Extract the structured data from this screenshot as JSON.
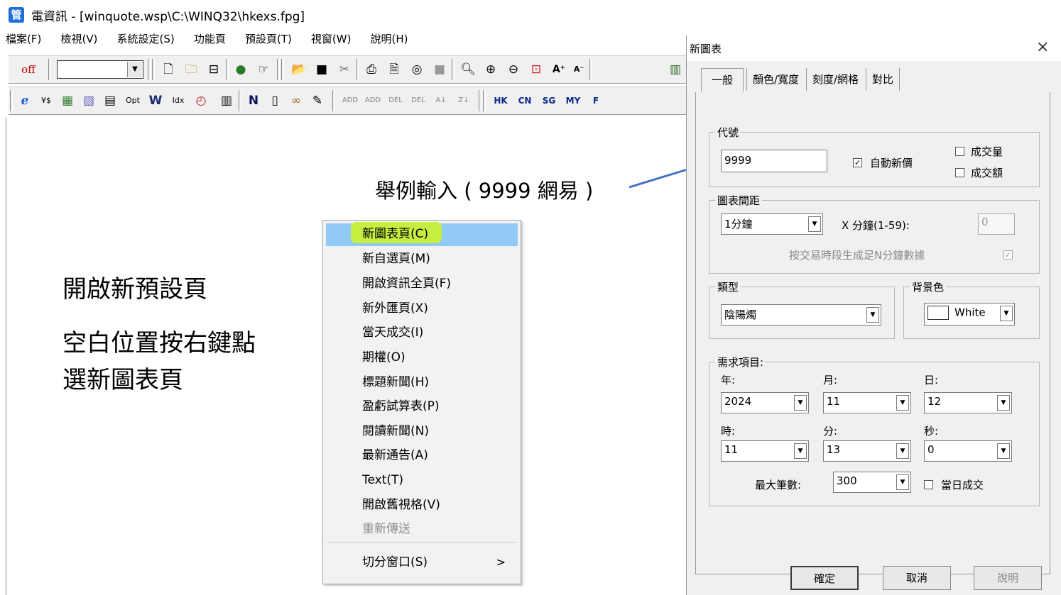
{
  "window": {
    "title": "電資訊 - [winquote.wsp\\C:\\WINQ32\\hkexs.fpg]",
    "icon": "app-icon"
  },
  "menubar": [
    "檔案(F)",
    "檢視(V)",
    "系統設定(S)",
    "功能頁",
    "預設頁(T)",
    "視窗(W)",
    "說明(H)"
  ],
  "toolbar1": {
    "off_label": "off",
    "combo_value": "",
    "icons": [
      "new-page-icon",
      "open-folder-icon",
      "minus-window-icon",
      "globe-icon",
      "hand-pointer-icon",
      "open-file-icon",
      "save-icon",
      "cut-icon",
      "print-icon",
      "print-preview-icon",
      "view-icon",
      "gray-box-icon",
      "search-icon",
      "zoom-in-icon",
      "zoom-out-icon",
      "target-icon",
      "font-larger-icon",
      "font-smaller-icon",
      "chart-icon"
    ]
  },
  "toolbar2": {
    "icons": [
      "ie-icon",
      "currency-icon",
      "grid-icon",
      "chart-line-icon",
      "table-icon",
      "option-icon",
      "w-icon",
      "index-icon",
      "clock-icon",
      "calculator-icon",
      "n-icon",
      "book-icon",
      "binoculars-icon",
      "pen-icon"
    ],
    "sort_buttons": [
      "ADD",
      "ADD",
      "DEL",
      "DEL",
      "A↓",
      "Z↓"
    ],
    "market_buttons": [
      "HK",
      "CN",
      "SG",
      "MY",
      "F"
    ]
  },
  "annotation": {
    "example": "舉例輸入 ( 9999 網易 )",
    "instr_title": "開啟新預設頁",
    "instr_line1": "空白位置按右鍵點",
    "instr_line2": "選新圖表頁"
  },
  "context_menu": {
    "items": [
      {
        "label": "新圖表頁(C)",
        "highlighted": true
      },
      {
        "label": "新自選頁(M)"
      },
      {
        "label": "開啟資訊全頁(F)"
      },
      {
        "label": "新外匯頁(X)"
      },
      {
        "label": "當天成交(I)"
      },
      {
        "label": "期權(O)"
      },
      {
        "label": "標題新聞(H)"
      },
      {
        "label": "盈虧試算表(P)"
      },
      {
        "label": "閱讀新聞(N)"
      },
      {
        "label": "最新通告(A)"
      },
      {
        "label": "Text(T)"
      },
      {
        "label": "開啟舊視格(V)"
      },
      {
        "label": "重新傳送",
        "disabled": true
      },
      {
        "label": "切分窗口(S)",
        "submenu": true
      }
    ],
    "submenu_arrow": ">"
  },
  "dialog": {
    "title": "新圖表",
    "close": "×",
    "tabs": [
      "一般",
      "顏色/寬度",
      "刻度/網格",
      "對比"
    ],
    "code_group": {
      "label": "代號",
      "code_value": "9999",
      "auto_new_price_label": "自動新價",
      "auto_new_price_checked": "✓",
      "volume_label": "成交量",
      "turnover_label": "成交額"
    },
    "interval_group": {
      "label": "圖表間距",
      "interval_value": "1分鐘",
      "x_minutes_label": "X 分鐘(1-59):",
      "x_minutes_value": "0",
      "fill_label": "按交易時段生成足N分鐘數據",
      "fill_checked": "✓"
    },
    "type_group": {
      "label": "類型",
      "value": "陰陽燭"
    },
    "bg_group": {
      "label": "背景色",
      "value": "White",
      "color": "#ffffff"
    },
    "request_group": {
      "label": "需求項目:",
      "year_label": "年:",
      "month_label": "月:",
      "day_label": "日:",
      "year_value": "2024",
      "month_value": "11",
      "day_value": "12",
      "hour_label": "時:",
      "minute_label": "分:",
      "second_label": "秒:",
      "hour_value": "11",
      "minute_value": "13",
      "second_value": "0",
      "max_records_label": "最大筆數:",
      "max_records_value": "300",
      "today_trades_label": "當日成交"
    },
    "buttons": {
      "ok": "確定",
      "cancel": "取消",
      "help": "說明"
    }
  },
  "colors": {
    "highlight": "#c8f036",
    "menu_selected": "#91c9f7",
    "arrow": "#4472c4"
  }
}
